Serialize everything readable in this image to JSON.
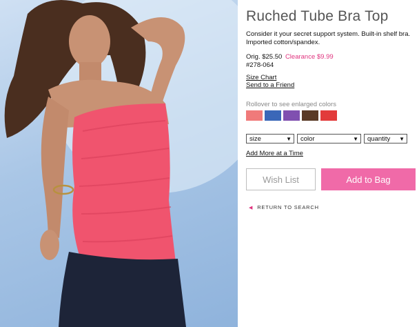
{
  "product": {
    "title": "Ruched Tube Bra Top",
    "description": "Consider it your secret support system. Built-in shelf bra. Imported cotton/spandex.",
    "orig_price": "Orig. $25.50",
    "sale_price": "Clearance $9.99",
    "sku": "#278-064"
  },
  "links": {
    "size_chart": "Size Chart",
    "send_to_friend": "Send to a Friend",
    "add_more": "Add More at a Time",
    "return_to_search": "RETURN TO SEARCH"
  },
  "colors": {
    "rollover_label": "Rollover to see enlarged colors",
    "swatches": [
      "#f07a7a",
      "#3a67b8",
      "#8050b0",
      "#5a3a26",
      "#e23b3b"
    ]
  },
  "selects": {
    "size": "size",
    "color": "color",
    "quantity": "quantity"
  },
  "buttons": {
    "wish_list": "Wish List",
    "add_to_bag": "Add to Bag"
  },
  "theme": {
    "accent_pink": "#f06aa8",
    "sale_pink": "#e0337e"
  }
}
